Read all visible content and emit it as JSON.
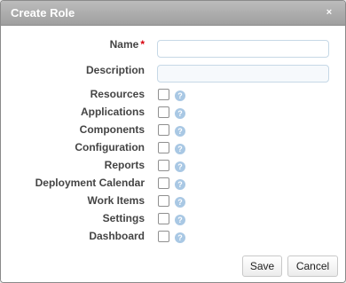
{
  "dialog": {
    "title": "Create Role",
    "close_symbol": "×"
  },
  "form": {
    "name": {
      "label": "Name",
      "required_marker": "*",
      "value": ""
    },
    "description": {
      "label": "Description",
      "value": ""
    },
    "permissions": [
      {
        "label": "Resources",
        "checked": false
      },
      {
        "label": "Applications",
        "checked": false
      },
      {
        "label": "Components",
        "checked": false
      },
      {
        "label": "Configuration",
        "checked": false
      },
      {
        "label": "Reports",
        "checked": false
      },
      {
        "label": "Deployment Calendar",
        "checked": false
      },
      {
        "label": "Work Items",
        "checked": false
      },
      {
        "label": "Settings",
        "checked": false
      },
      {
        "label": "Dashboard",
        "checked": false
      }
    ],
    "help_symbol": "?"
  },
  "buttons": {
    "save": "Save",
    "cancel": "Cancel"
  },
  "icons": {
    "help": "help-icon",
    "close": "close-icon"
  },
  "colors": {
    "titlebar": "#a9a9a9",
    "required": "#d8000c",
    "help": "#a9c8e4"
  }
}
